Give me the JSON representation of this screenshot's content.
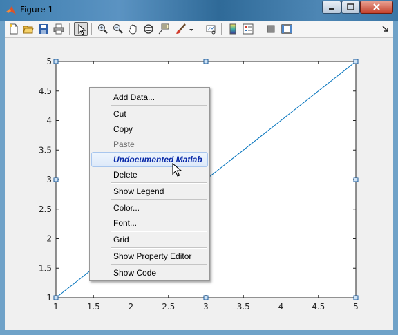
{
  "window": {
    "title": "Figure 1"
  },
  "toolbar": {
    "buttons": [
      {
        "name": "new-figure-icon"
      },
      {
        "name": "open-file-icon"
      },
      {
        "name": "save-icon"
      },
      {
        "name": "print-icon"
      },
      {
        "name": "edit-plot-icon"
      },
      {
        "name": "zoom-in-icon"
      },
      {
        "name": "zoom-out-icon"
      },
      {
        "name": "pan-icon"
      },
      {
        "name": "rotate-3d-icon"
      },
      {
        "name": "data-cursor-icon"
      },
      {
        "name": "brush-icon"
      },
      {
        "name": "link-plot-icon"
      },
      {
        "name": "insert-colorbar-icon"
      },
      {
        "name": "insert-legend-icon"
      },
      {
        "name": "hide-plot-tools-icon"
      },
      {
        "name": "show-plot-tools-icon"
      }
    ]
  },
  "chart_data": {
    "type": "line",
    "x": [
      1,
      5
    ],
    "y": [
      1,
      5
    ],
    "xlim": [
      1,
      5
    ],
    "ylim": [
      1,
      5
    ],
    "xticks": [
      "1",
      "1.5",
      "2",
      "2.5",
      "3",
      "3.5",
      "4",
      "4.5",
      "5"
    ],
    "yticks": [
      "1",
      "1.5",
      "2",
      "2.5",
      "3",
      "3.5",
      "4",
      "4.5",
      "5"
    ],
    "line_color": "#0072bd",
    "grid": false
  },
  "context_menu": {
    "add_data": "Add Data...",
    "cut": "Cut",
    "copy": "Copy",
    "paste": "Paste",
    "undocumented": "Undocumented Matlab",
    "delete": "Delete",
    "show_legend": "Show Legend",
    "color": "Color...",
    "font": "Font...",
    "grid": "Grid",
    "show_property_editor": "Show Property Editor",
    "show_code": "Show Code"
  }
}
